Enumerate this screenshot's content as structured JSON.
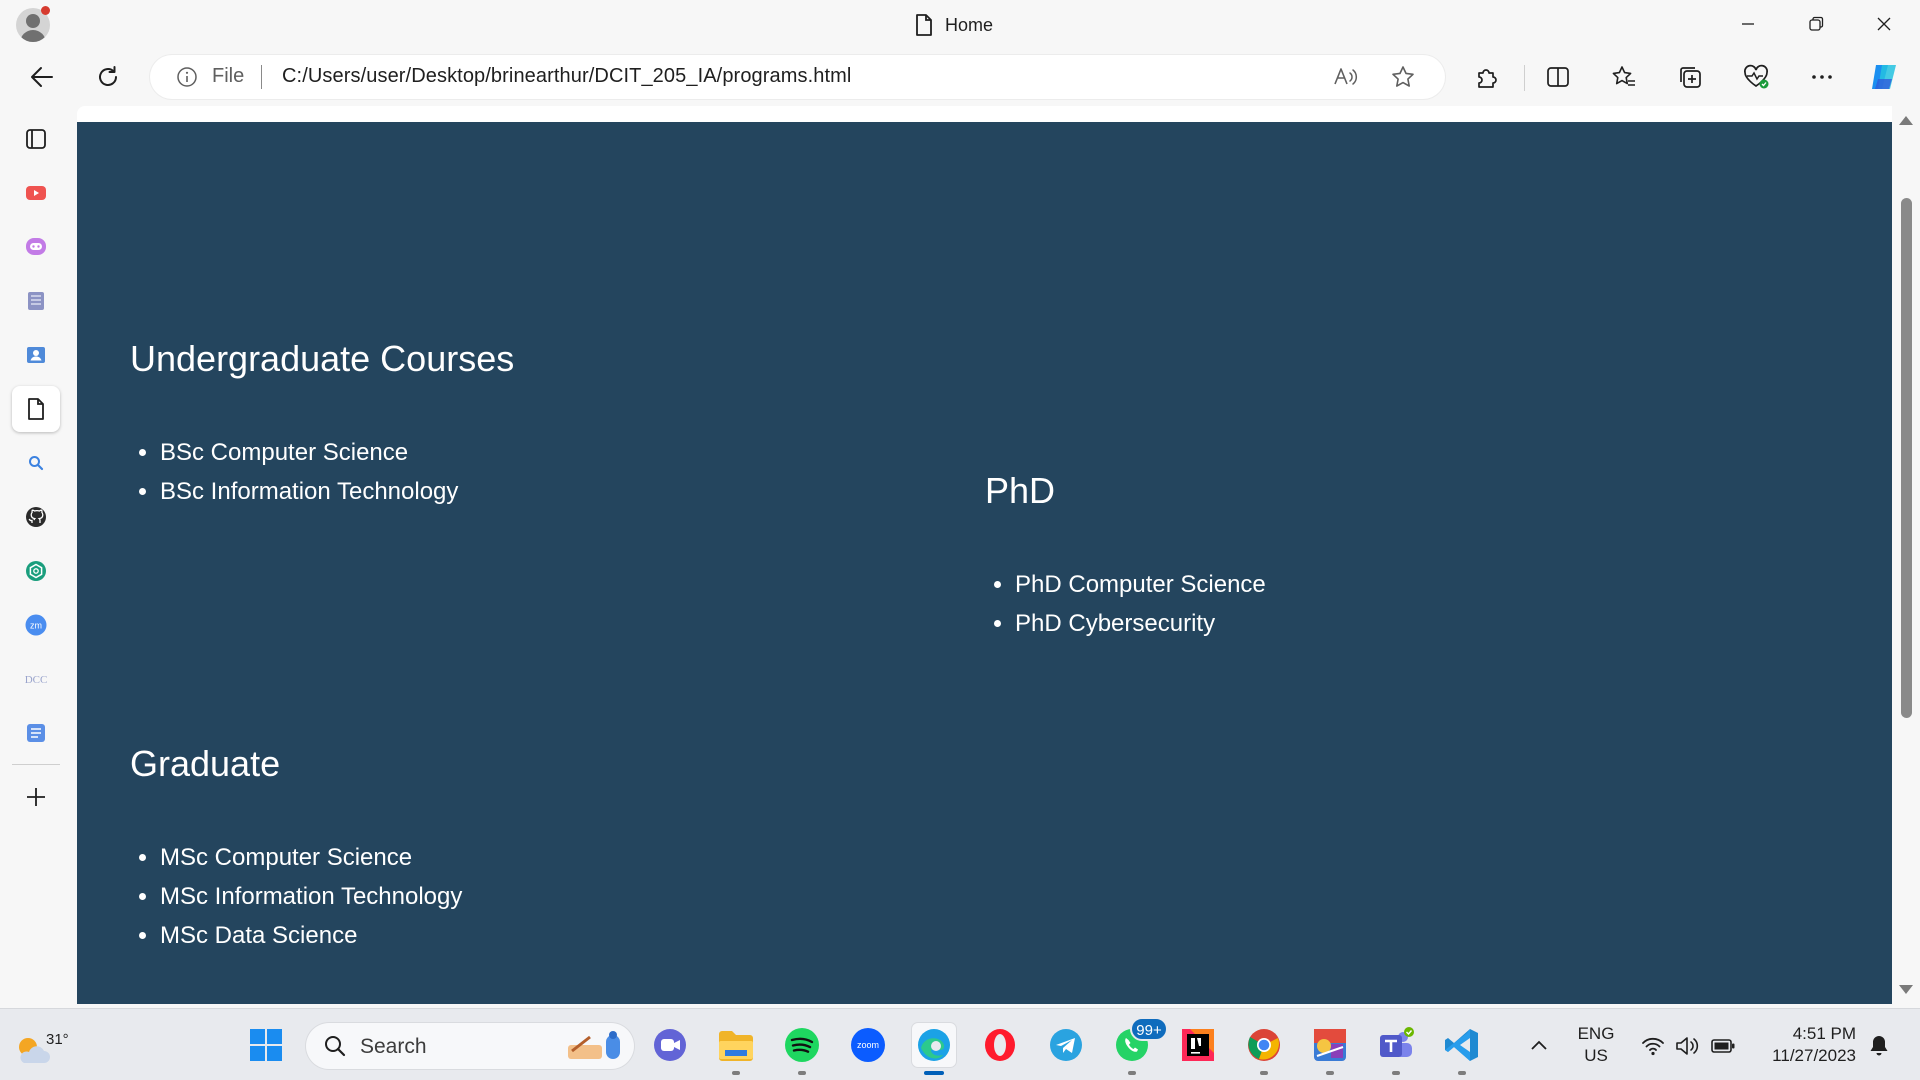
{
  "window": {
    "tab_title": "Home"
  },
  "toolbar": {
    "file_label": "File",
    "url": "C:/Users/user/Desktop/brinearthur/DCIT_205_IA/programs.html"
  },
  "sidebar": {
    "items": [
      "tabs-icon",
      "youtube-icon",
      "chat-icon",
      "university-icon",
      "contact-icon",
      "document-icon",
      "search-icon",
      "github-icon",
      "chatgpt-icon",
      "zoom-icon",
      "dcc-icon",
      "notes-icon",
      "add-icon"
    ]
  },
  "page": {
    "background_color": "#24455e",
    "undergraduate": {
      "heading": "Undergraduate Courses",
      "items": [
        "BSc Computer Science",
        "BSc Information Technology"
      ]
    },
    "phd": {
      "heading": "PhD",
      "items": [
        "PhD Computer Science",
        "PhD Cybersecurity"
      ]
    },
    "graduate": {
      "heading": "Graduate",
      "items": [
        "MSc Computer Science",
        "MSc Information Technology",
        "MSc Data Science"
      ]
    }
  },
  "taskbar": {
    "weather_temp": "31°",
    "search_label": "Search",
    "whatsapp_badge": "99+",
    "lang_line1": "ENG",
    "lang_line2": "US",
    "time": "4:51 PM",
    "date": "11/27/2023"
  }
}
